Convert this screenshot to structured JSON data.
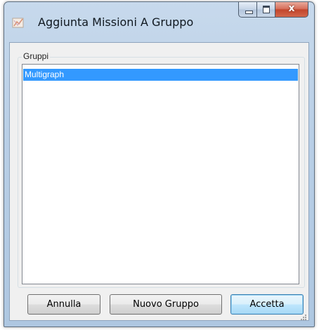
{
  "window": {
    "title": "Aggiunta Missioni A Gruppo",
    "app_icon": "application-icon",
    "caption_buttons": {
      "minimize_icon": "minimize-icon",
      "maximize_icon": "maximize-icon",
      "close_icon": "close-icon",
      "close_glyph": "x"
    }
  },
  "groups_box": {
    "label": "Gruppi",
    "items": [
      {
        "label": "Multigraph",
        "selected": true
      }
    ]
  },
  "buttons": {
    "cancel_label": "Annulla",
    "new_group_label": "Nuovo Gruppo",
    "accept_label": "Accetta"
  },
  "colors": {
    "selection": "#3399ff",
    "close_button": "#c2462c",
    "default_button_border": "#3c7fb1"
  }
}
